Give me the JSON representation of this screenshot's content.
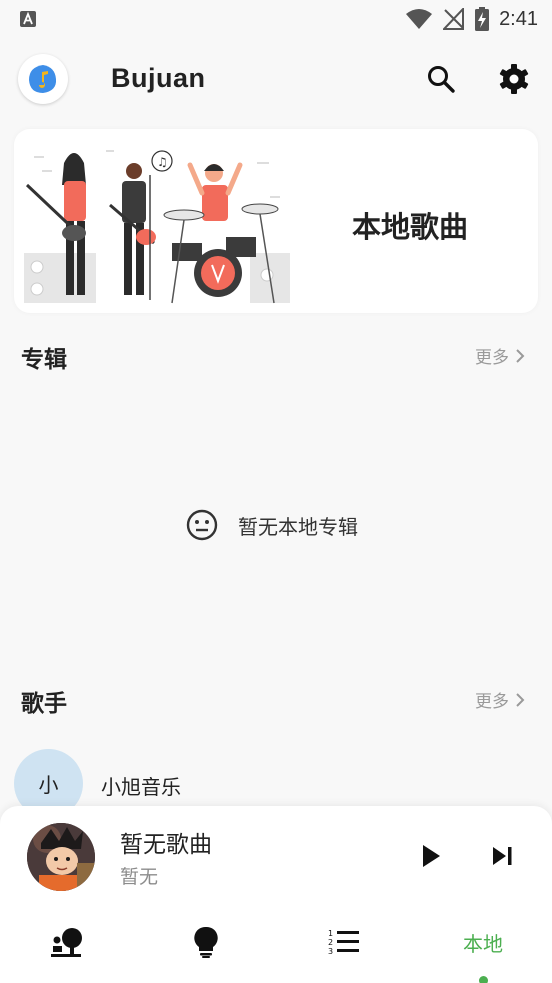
{
  "status_bar": {
    "time": "2:41",
    "icons": [
      "text-a-icon",
      "wifi-icon",
      "signal-off-icon",
      "battery-charging-icon"
    ]
  },
  "header": {
    "app_title": "Bujuan",
    "icons": [
      "app-logo-icon",
      "search-icon",
      "settings-gear-icon"
    ]
  },
  "banner": {
    "title": "本地歌曲"
  },
  "albums": {
    "title": "专辑",
    "more_label": "更多",
    "empty_text": "暂无本地专辑",
    "empty_icon": "neutral-face-icon"
  },
  "artists": {
    "title": "歌手",
    "more_label": "更多",
    "items": [
      {
        "avatar_text": "小",
        "name": "小旭音乐"
      }
    ]
  },
  "mini_player": {
    "song_title": "暂无歌曲",
    "artist": "暂无",
    "controls": [
      "play-icon",
      "skip-next-icon"
    ]
  },
  "bottom_nav": {
    "items": [
      {
        "icon": "person-tree-icon"
      },
      {
        "icon": "lightbulb-icon"
      },
      {
        "icon": "numbered-list-icon"
      },
      {
        "label": "本地",
        "active": true
      }
    ],
    "accent_color": "#4caf50"
  },
  "colors": {
    "background": "#f8f8f8",
    "card": "#ffffff",
    "accent": "#4caf50",
    "avatar_bg": "#cfe3f2",
    "illustration_accent": "#f26b5b"
  }
}
